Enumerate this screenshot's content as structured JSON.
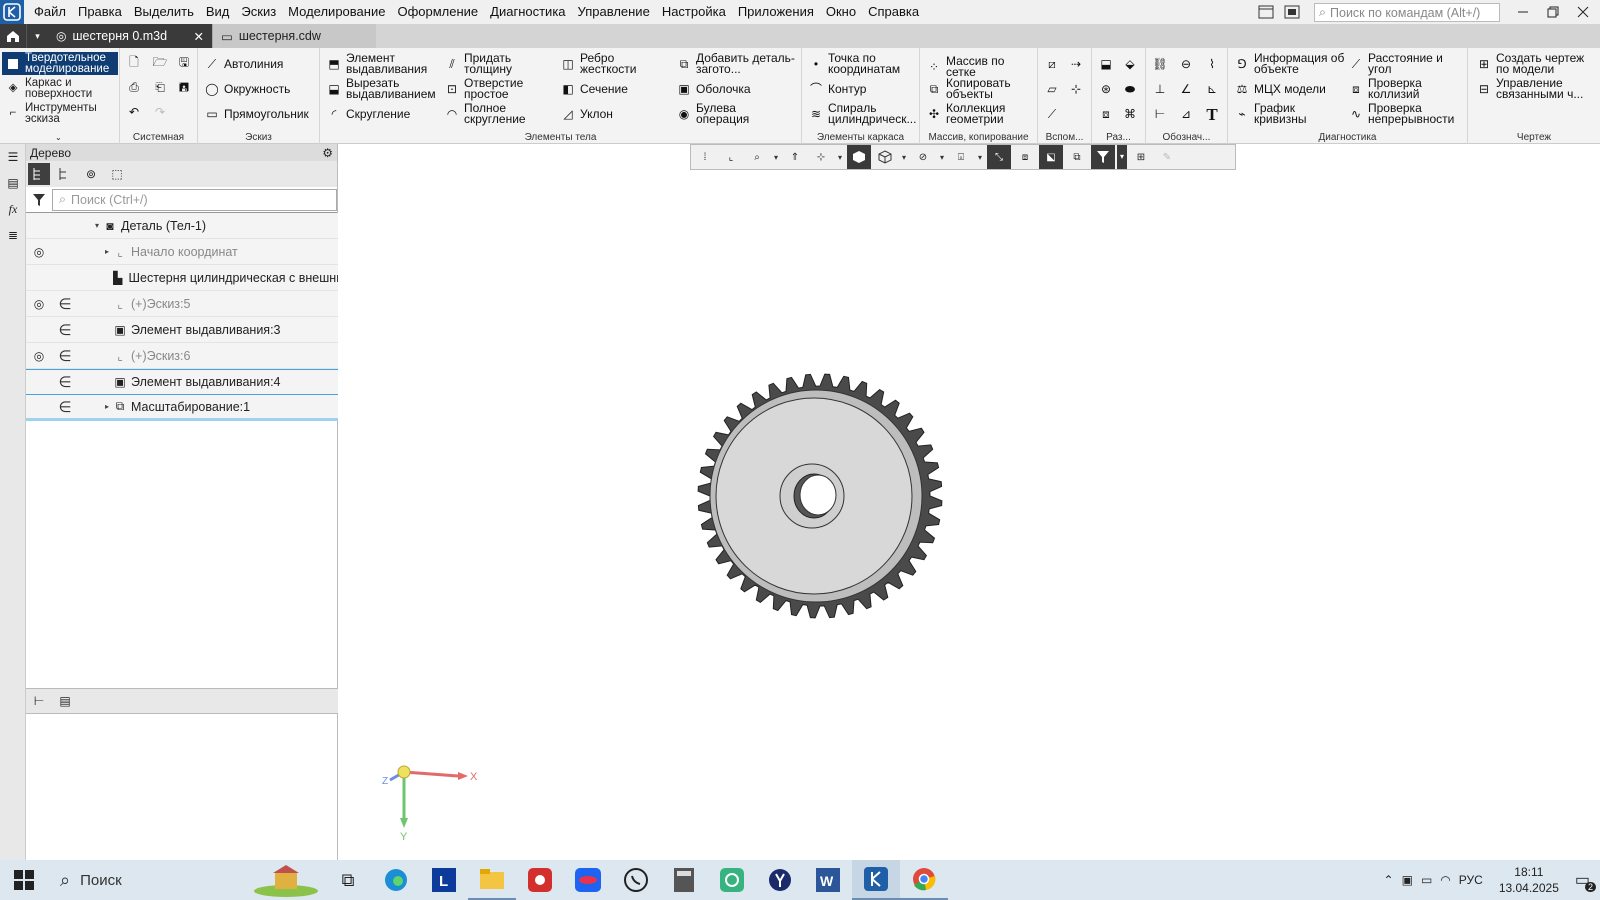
{
  "menu": [
    "Файл",
    "Правка",
    "Выделить",
    "Вид",
    "Эскиз",
    "Моделирование",
    "Оформление",
    "Диагностика",
    "Управление",
    "Настройка",
    "Приложения",
    "Окно",
    "Справка"
  ],
  "command_search_placeholder": "Поиск по командам (Alt+/)",
  "tabs": {
    "active": "шестерня 0.m3d",
    "inactive": "шестерня.cdw"
  },
  "ribbon": {
    "modes": [
      "Твердотельное моделирование",
      "Каркас и поверхности",
      "Инструменты эскиза"
    ],
    "groups": {
      "system": "Системная",
      "sketch": "Эскиз",
      "body": "Элементы тела",
      "frame": "Элементы каркаса",
      "array": "Массив, копирование",
      "aux": "Вспом...",
      "raz": "Раз...",
      "notation": "Обознач...",
      "diagnostics": "Диагностика",
      "drawing": "Чертеж"
    },
    "sketch_btns": [
      "Автолиния",
      "Окружность",
      "Прямоугольник"
    ],
    "body_btns": [
      "Элемент выдавливания",
      "Вырезать выдавливанием",
      "Скругление",
      "Придать толщину",
      "Отверстие простое",
      "Полное скругление",
      "Ребро жесткости",
      "Сечение",
      "Уклон",
      "Добавить деталь-загото...",
      "Оболочка",
      "Булева операция"
    ],
    "frame_btns": [
      "Точка по координатам",
      "Контур",
      "Спираль цилиндрическ..."
    ],
    "array_btns": [
      "Массив по сетке",
      "Копировать объекты",
      "Коллекция геометрии"
    ],
    "diag_btns": [
      "Информация об объекте",
      "МЦХ модели",
      "График кривизны",
      "Расстояние и угол",
      "Проверка коллизий",
      "Проверка непрерывности"
    ],
    "drawing_btns": [
      "Создать чертеж по модели",
      "Управление связанными ч..."
    ]
  },
  "tree": {
    "title": "Дерево",
    "search_placeholder": "Поиск (Ctrl+/)",
    "rows": [
      {
        "label": "Деталь (Тел-1)",
        "dim": false
      },
      {
        "label": "Начало координат",
        "dim": true
      },
      {
        "label": "Шестерня цилиндрическая с внешни",
        "dim": false
      },
      {
        "label": "(+)Эскиз:5",
        "dim": true
      },
      {
        "label": "Элемент выдавливания:3",
        "dim": false
      },
      {
        "label": "(+)Эскиз:6",
        "dim": true
      },
      {
        "label": "Элемент выдавливания:4",
        "dim": false
      },
      {
        "label": "Масштабирование:1",
        "dim": false
      }
    ]
  },
  "axes": {
    "x": "X",
    "y": "Y",
    "z": "Z"
  },
  "taskbar": {
    "search": "Поиск",
    "lang": "РУС",
    "time": "18:11",
    "date": "13.04.2025",
    "notifications": "2"
  },
  "colors": {
    "accent": "#0f3d73",
    "gear_face": "#d8d8d8",
    "gear_dark": "#4a4a4a"
  }
}
